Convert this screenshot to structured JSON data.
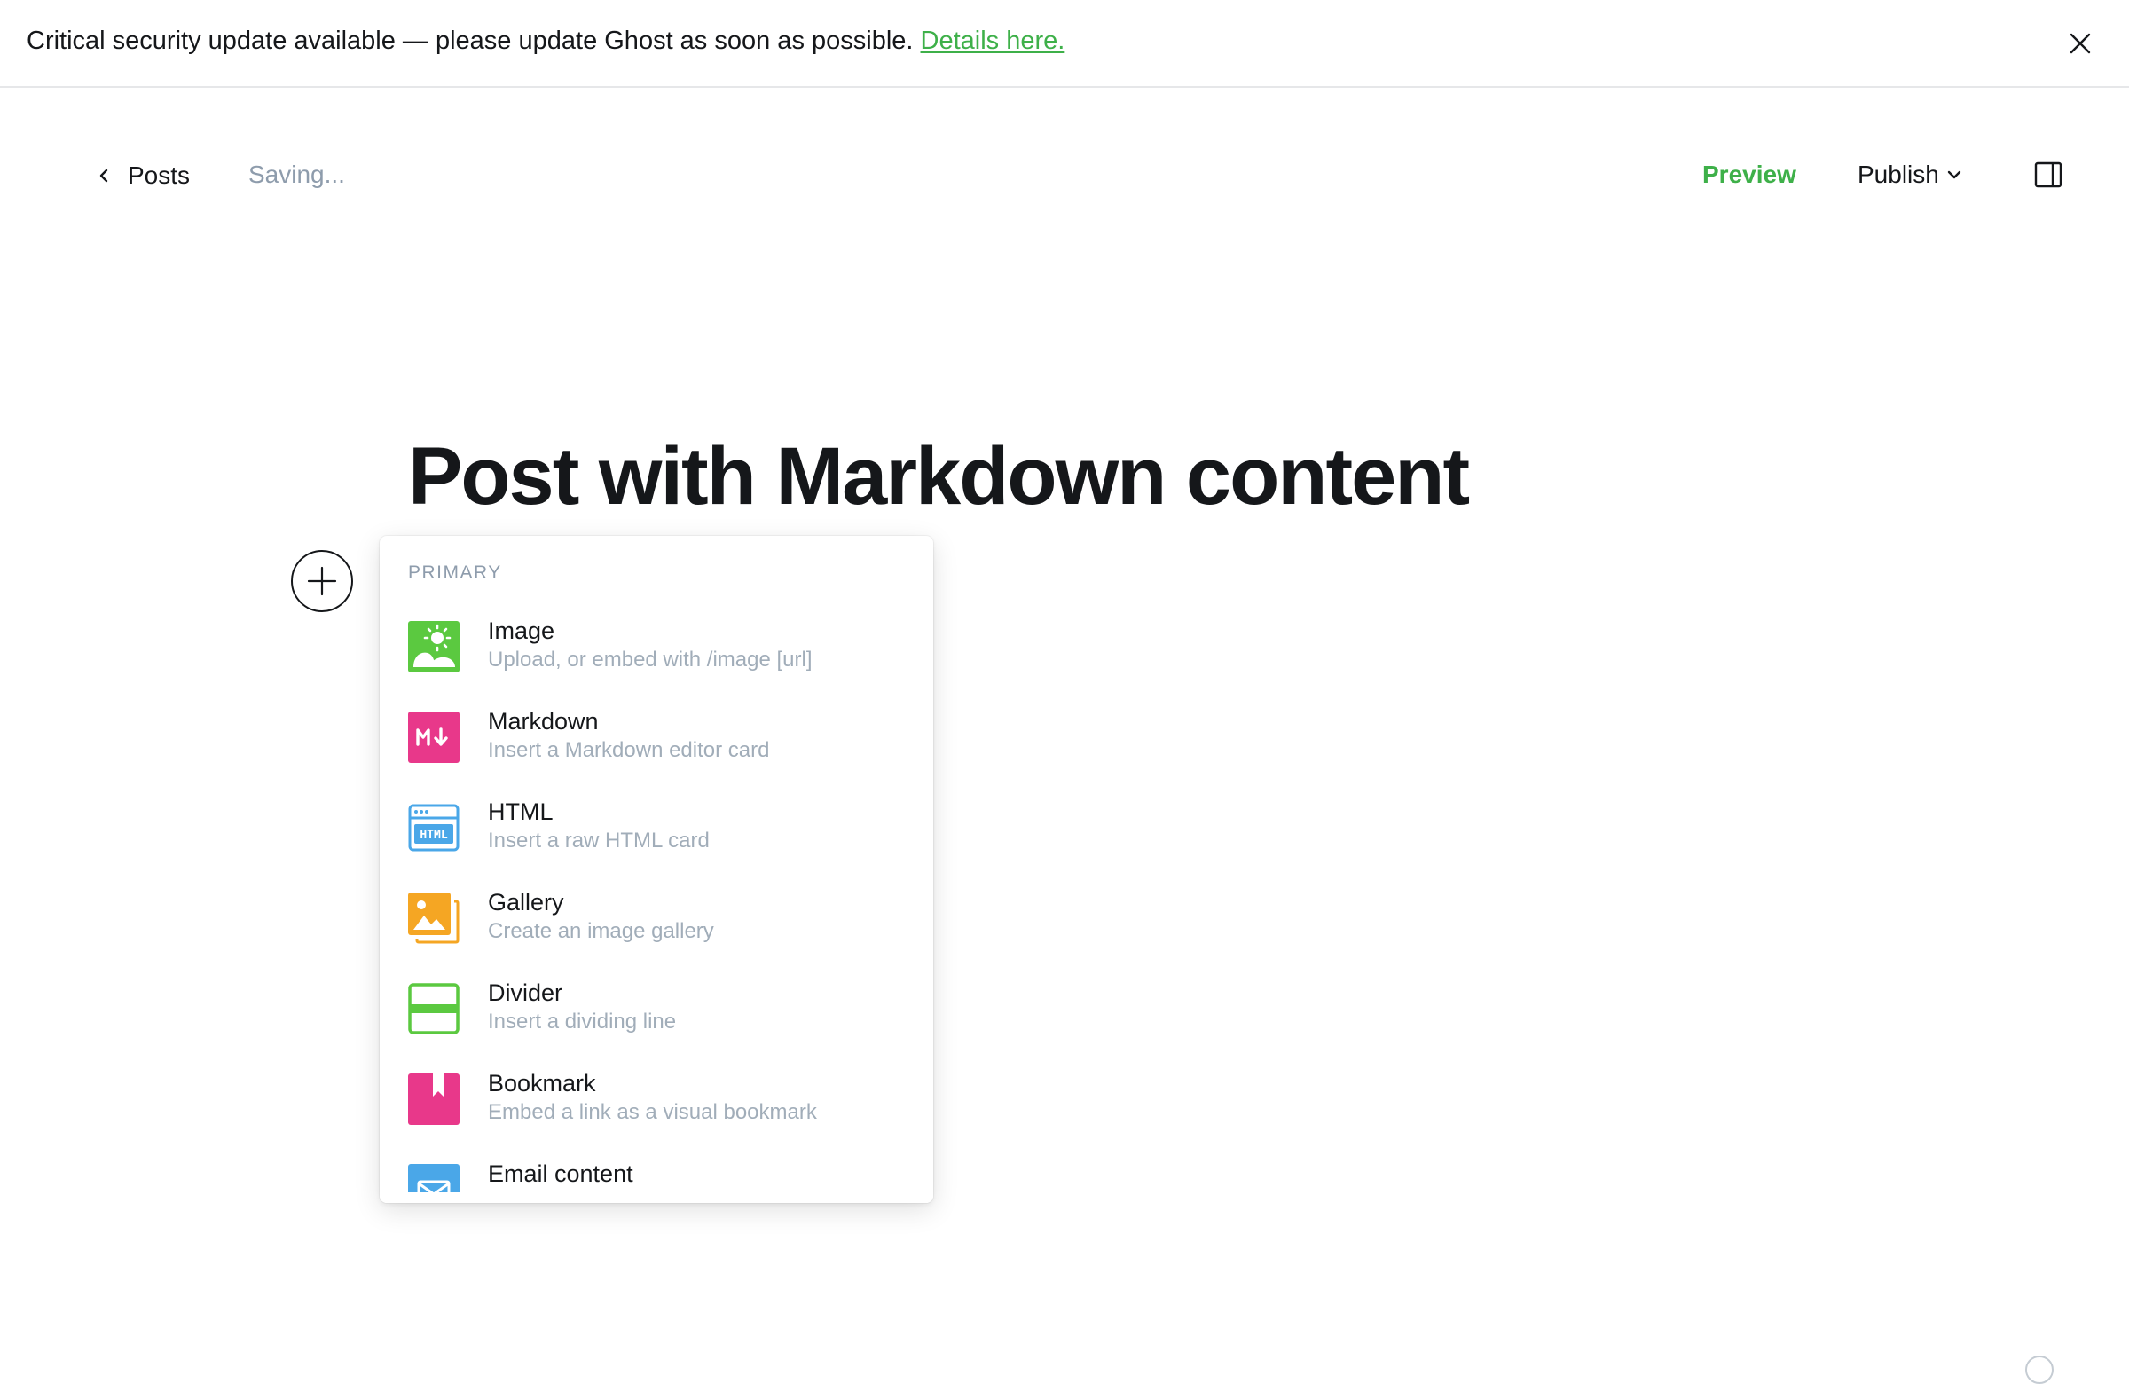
{
  "banner": {
    "message": "Critical security update available — please update Ghost as soon as possible.",
    "link_text": "Details here."
  },
  "header": {
    "back_label": "Posts",
    "status": "Saving...",
    "preview_label": "Preview",
    "publish_label": "Publish"
  },
  "post": {
    "title": "Post with Markdown content"
  },
  "card_menu": {
    "section_title": "PRIMARY",
    "items": [
      {
        "label": "Image",
        "description": "Upload, or embed with /image [url]",
        "icon": "image-icon",
        "color": "#5bc940"
      },
      {
        "label": "Markdown",
        "description": "Insert a Markdown editor card",
        "icon": "markdown-icon",
        "color": "#e8388a"
      },
      {
        "label": "HTML",
        "description": "Insert a raw HTML card",
        "icon": "html-icon",
        "color": "#4aa7e8"
      },
      {
        "label": "Gallery",
        "description": "Create an image gallery",
        "icon": "gallery-icon",
        "color": "#f5a623"
      },
      {
        "label": "Divider",
        "description": "Insert a dividing line",
        "icon": "divider-icon",
        "color": "#5bc940"
      },
      {
        "label": "Bookmark",
        "description": "Embed a link as a visual bookmark",
        "icon": "bookmark-icon",
        "color": "#e8388a"
      },
      {
        "label": "Email content",
        "description": "",
        "icon": "email-icon",
        "color": "#4aa7e8"
      }
    ]
  },
  "colors": {
    "accent_green": "#3eb049",
    "text_dark": "#15171a",
    "text_muted": "#8e9cac"
  }
}
